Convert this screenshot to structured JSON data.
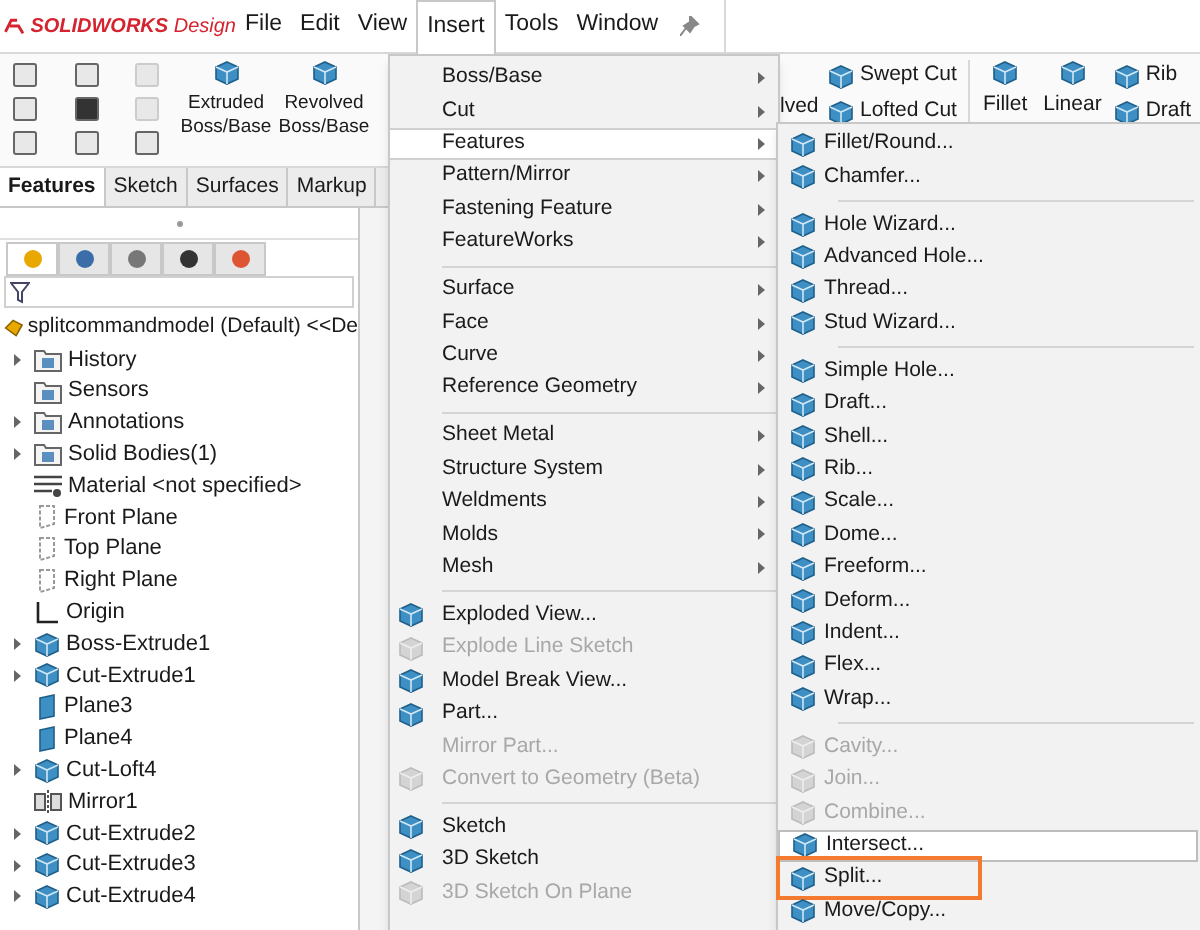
{
  "app": {
    "logo_brand": "SOLIDWORKS",
    "logo_suffix": "Design"
  },
  "menubar": [
    {
      "label": "File",
      "selected": false
    },
    {
      "label": "Edit",
      "selected": false
    },
    {
      "label": "View",
      "selected": false
    },
    {
      "label": "Insert",
      "selected": true
    },
    {
      "label": "Tools",
      "selected": false
    },
    {
      "label": "Window",
      "selected": false
    }
  ],
  "toolbar": {
    "large": [
      {
        "label": "Extruded Boss/Base"
      },
      {
        "label": "Revolved Boss/Base"
      }
    ],
    "covered_label": "lved",
    "stacked": [
      "Swept Cut",
      "Lofted Cut"
    ],
    "right": [
      {
        "label": "Fillet"
      },
      {
        "label": "Linear"
      }
    ],
    "right_stacked": [
      "Rib",
      "Draft"
    ]
  },
  "tabs": [
    {
      "label": "Features",
      "selected": true
    },
    {
      "label": "Sketch",
      "selected": false
    },
    {
      "label": "Surfaces",
      "selected": false
    },
    {
      "label": "Markup",
      "selected": false
    }
  ],
  "panel_tabs": [
    {
      "selected": true
    },
    {
      "selected": false
    },
    {
      "selected": false
    },
    {
      "selected": false
    },
    {
      "selected": false
    }
  ],
  "tree": {
    "root": "splitcommandmodel (Default) <<De",
    "items": [
      {
        "label": "History",
        "kind": "folder",
        "expandable": true
      },
      {
        "label": "Sensors",
        "kind": "folder",
        "expandable": false
      },
      {
        "label": "Annotations",
        "kind": "folder",
        "expandable": true
      },
      {
        "label": "Solid Bodies(1)",
        "kind": "folder",
        "expandable": true
      },
      {
        "label": "Material <not specified>",
        "kind": "material",
        "expandable": false
      },
      {
        "label": "Front Plane",
        "kind": "plane",
        "expandable": false
      },
      {
        "label": "Top Plane",
        "kind": "plane",
        "expandable": false
      },
      {
        "label": "Right Plane",
        "kind": "plane",
        "expandable": false
      },
      {
        "label": "Origin",
        "kind": "origin",
        "expandable": false
      },
      {
        "label": "Boss-Extrude1",
        "kind": "feature",
        "expandable": true
      },
      {
        "label": "Cut-Extrude1",
        "kind": "feature",
        "expandable": true
      },
      {
        "label": "Plane3",
        "kind": "refplane",
        "expandable": false
      },
      {
        "label": "Plane4",
        "kind": "refplane",
        "expandable": false
      },
      {
        "label": "Cut-Loft4",
        "kind": "feature",
        "expandable": true
      },
      {
        "label": "Mirror1",
        "kind": "mirror",
        "expandable": false
      },
      {
        "label": "Cut-Extrude2",
        "kind": "feature",
        "expandable": true
      },
      {
        "label": "Cut-Extrude3",
        "kind": "feature",
        "expandable": true
      },
      {
        "label": "Cut-Extrude4",
        "kind": "feature",
        "expandable": true
      }
    ]
  },
  "insert_menu": [
    {
      "kind": "item",
      "label": "Boss/Base",
      "submenu": true,
      "icon": false,
      "disabled": false,
      "selected": false
    },
    {
      "kind": "item",
      "label": "Cut",
      "submenu": true,
      "icon": false,
      "disabled": false,
      "selected": false
    },
    {
      "kind": "item",
      "label": "Features",
      "submenu": true,
      "icon": false,
      "disabled": false,
      "selected": true
    },
    {
      "kind": "item",
      "label": "Pattern/Mirror",
      "submenu": true,
      "icon": false,
      "disabled": false,
      "selected": false
    },
    {
      "kind": "item",
      "label": "Fastening Feature",
      "submenu": true,
      "icon": false,
      "disabled": false,
      "selected": false
    },
    {
      "kind": "item",
      "label": "FeatureWorks",
      "submenu": true,
      "icon": false,
      "disabled": false,
      "selected": false
    },
    {
      "kind": "separator"
    },
    {
      "kind": "item",
      "label": "Surface",
      "submenu": true,
      "icon": false,
      "disabled": false,
      "selected": false
    },
    {
      "kind": "item",
      "label": "Face",
      "submenu": true,
      "icon": false,
      "disabled": false,
      "selected": false
    },
    {
      "kind": "item",
      "label": "Curve",
      "submenu": true,
      "icon": false,
      "disabled": false,
      "selected": false
    },
    {
      "kind": "item",
      "label": "Reference Geometry",
      "submenu": true,
      "icon": false,
      "disabled": false,
      "selected": false
    },
    {
      "kind": "separator"
    },
    {
      "kind": "item",
      "label": "Sheet Metal",
      "submenu": true,
      "icon": false,
      "disabled": false,
      "selected": false
    },
    {
      "kind": "item",
      "label": "Structure System",
      "submenu": true,
      "icon": false,
      "disabled": false,
      "selected": false
    },
    {
      "kind": "item",
      "label": "Weldments",
      "submenu": true,
      "icon": false,
      "disabled": false,
      "selected": false
    },
    {
      "kind": "item",
      "label": "Molds",
      "submenu": true,
      "icon": false,
      "disabled": false,
      "selected": false
    },
    {
      "kind": "item",
      "label": "Mesh",
      "submenu": true,
      "icon": false,
      "disabled": false,
      "selected": false
    },
    {
      "kind": "separator"
    },
    {
      "kind": "item",
      "label": "Exploded View...",
      "submenu": false,
      "icon": true,
      "disabled": false,
      "selected": false
    },
    {
      "kind": "item",
      "label": "Explode Line Sketch",
      "submenu": false,
      "icon": true,
      "disabled": true,
      "selected": false
    },
    {
      "kind": "item",
      "label": "Model Break View...",
      "submenu": false,
      "icon": true,
      "disabled": false,
      "selected": false
    },
    {
      "kind": "item",
      "label": "Part...",
      "submenu": false,
      "icon": true,
      "disabled": false,
      "selected": false
    },
    {
      "kind": "item",
      "label": "Mirror Part...",
      "submenu": false,
      "icon": false,
      "disabled": true,
      "selected": false
    },
    {
      "kind": "item",
      "label": "Convert to Geometry (Beta)",
      "submenu": false,
      "icon": true,
      "disabled": true,
      "selected": false
    },
    {
      "kind": "separator"
    },
    {
      "kind": "item",
      "label": "Sketch",
      "submenu": false,
      "icon": true,
      "disabled": false,
      "selected": false
    },
    {
      "kind": "item",
      "label": "3D Sketch",
      "submenu": false,
      "icon": true,
      "disabled": false,
      "selected": false
    },
    {
      "kind": "item",
      "label": "3D Sketch On Plane",
      "submenu": false,
      "icon": true,
      "disabled": true,
      "selected": false
    }
  ],
  "features_menu": [
    {
      "kind": "item",
      "label": "Fillet/Round...",
      "disabled": false,
      "selected": false,
      "marked": false
    },
    {
      "kind": "item",
      "label": "Chamfer...",
      "disabled": false,
      "selected": false,
      "marked": false
    },
    {
      "kind": "separator"
    },
    {
      "kind": "item",
      "label": "Hole Wizard...",
      "disabled": false,
      "selected": false,
      "marked": false
    },
    {
      "kind": "item",
      "label": "Advanced Hole...",
      "disabled": false,
      "selected": false,
      "marked": false
    },
    {
      "kind": "item",
      "label": "Thread...",
      "disabled": false,
      "selected": false,
      "marked": false
    },
    {
      "kind": "item",
      "label": "Stud Wizard...",
      "disabled": false,
      "selected": false,
      "marked": false
    },
    {
      "kind": "separator"
    },
    {
      "kind": "item",
      "label": "Simple Hole...",
      "disabled": false,
      "selected": false,
      "marked": false
    },
    {
      "kind": "item",
      "label": "Draft...",
      "disabled": false,
      "selected": false,
      "marked": false
    },
    {
      "kind": "item",
      "label": "Shell...",
      "disabled": false,
      "selected": false,
      "marked": false
    },
    {
      "kind": "item",
      "label": "Rib...",
      "disabled": false,
      "selected": false,
      "marked": false
    },
    {
      "kind": "item",
      "label": "Scale...",
      "disabled": false,
      "selected": false,
      "marked": false
    },
    {
      "kind": "item",
      "label": "Dome...",
      "disabled": false,
      "selected": false,
      "marked": false
    },
    {
      "kind": "item",
      "label": "Freeform...",
      "disabled": false,
      "selected": false,
      "marked": false
    },
    {
      "kind": "item",
      "label": "Deform...",
      "disabled": false,
      "selected": false,
      "marked": false
    },
    {
      "kind": "item",
      "label": "Indent...",
      "disabled": false,
      "selected": false,
      "marked": false
    },
    {
      "kind": "item",
      "label": "Flex...",
      "disabled": false,
      "selected": false,
      "marked": false
    },
    {
      "kind": "item",
      "label": "Wrap...",
      "disabled": false,
      "selected": false,
      "marked": false
    },
    {
      "kind": "separator"
    },
    {
      "kind": "item",
      "label": "Cavity...",
      "disabled": true,
      "selected": false,
      "marked": false
    },
    {
      "kind": "item",
      "label": "Join...",
      "disabled": true,
      "selected": false,
      "marked": false
    },
    {
      "kind": "item",
      "label": "Combine...",
      "disabled": true,
      "selected": false,
      "marked": false
    },
    {
      "kind": "item",
      "label": "Intersect...",
      "disabled": false,
      "selected": true,
      "marked": false
    },
    {
      "kind": "item",
      "label": "Split...",
      "disabled": false,
      "selected": false,
      "marked": true
    },
    {
      "kind": "item",
      "label": "Move/Copy...",
      "disabled": false,
      "selected": false,
      "marked": false
    }
  ]
}
